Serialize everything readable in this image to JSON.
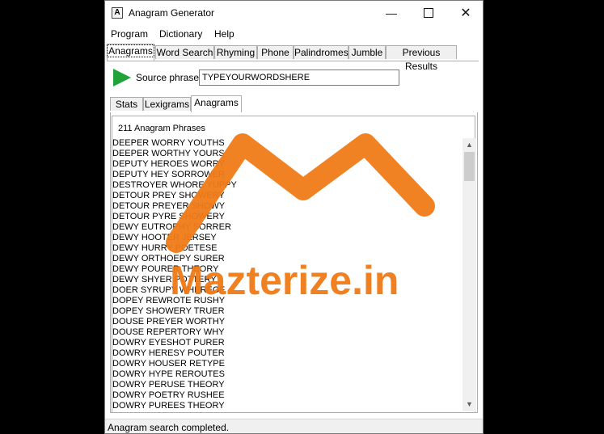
{
  "window": {
    "title": "Anagram Generator",
    "icon_letter": "A"
  },
  "menu": [
    "Program",
    "Dictionary",
    "Help"
  ],
  "main_tabs": [
    "Anagrams",
    "Word Search",
    "Rhyming",
    "Phone",
    "Palindromes",
    "Jumble",
    "Previous Results"
  ],
  "source": {
    "label": "Source phrase",
    "value": "TYPEYOURWORDSHERE"
  },
  "sub_tabs": [
    "Stats",
    "Lexigrams",
    "Anagrams"
  ],
  "results": {
    "count_label": "211 Anagram Phrases",
    "items": [
      "DEEPER WORRY YOUTHS",
      "DEEPER WORTHY YOURS",
      "DEPUTY HEROES WORRY",
      "DEPUTY HEY SORROWER",
      "DESTROYER WHORE YUPPY",
      "DETOUR PREY SHOWERY",
      "DETOUR PREYER SHOWY",
      "DETOUR PYRE SHOWERY",
      "DEWY EUTROPHY SORRER",
      "DEWY HOOTER JERSEY",
      "DEWY HURRY POETESE",
      "DEWY ORTHOEPY SURER",
      "DEWY POURER THEORY",
      "DEWY SHYER POTTERY",
      "DOER SYRUPY WHEREOF",
      "DOPEY REWROTE RUSHY",
      "DOPEY SHOWERY TRUER",
      "DOUSE PREYER WORTHY",
      "DOUSE REPERTORY WHY",
      "DOWRY EYESHOT PURER",
      "DOWRY HERESY POUTER",
      "DOWRY HOUSER RETYPE",
      "DOWRY HYPE REROUTES",
      "DOWRY PERUSE THEORY",
      "DOWRY POETRY RUSHEE",
      "DOWRY PUREES THEORY"
    ]
  },
  "status": "Anagram search completed.",
  "watermark": "Mazterize.in",
  "colors": {
    "accent_green": "#21a33a",
    "watermark_orange": "#f07b18"
  }
}
